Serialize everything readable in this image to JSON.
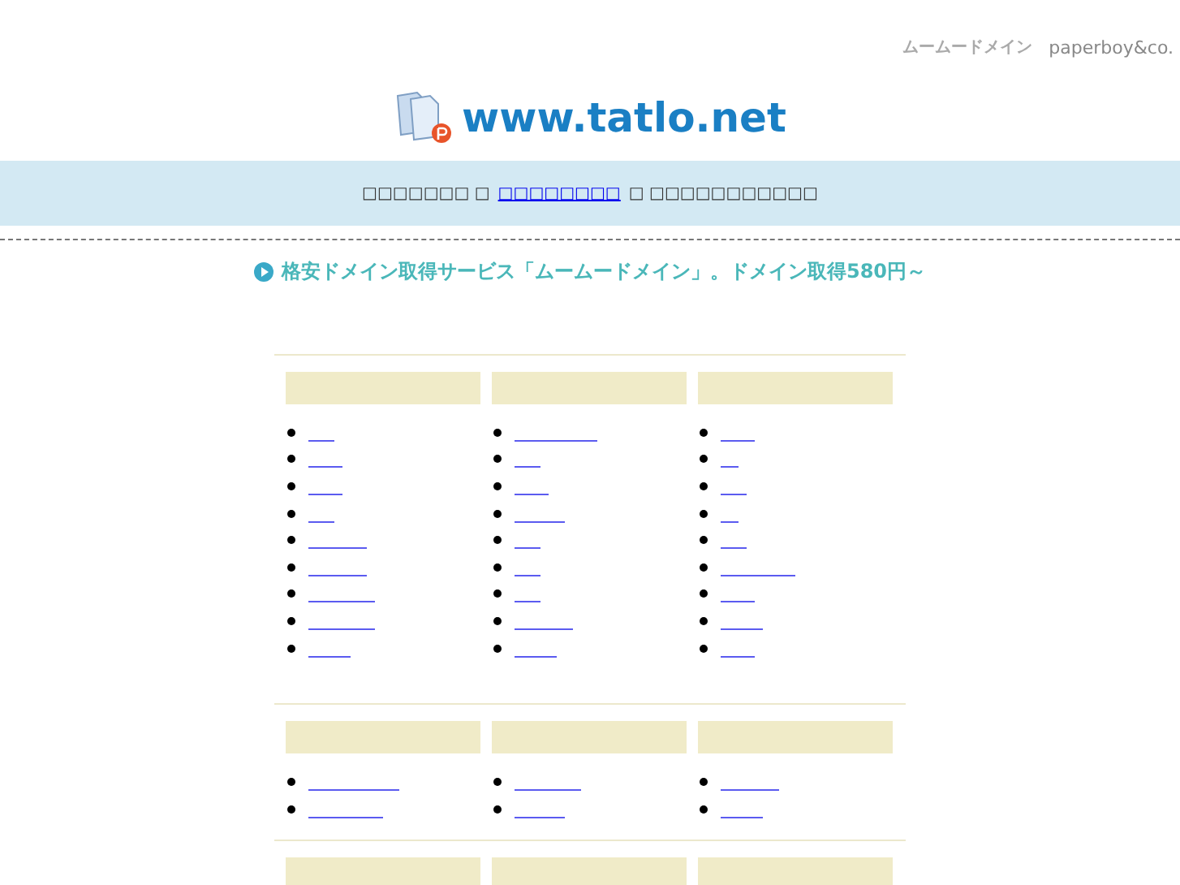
{
  "top_logos": [
    "ムームードメイン",
    "paperboy&co."
  ],
  "site_title": "www.tatlo.net",
  "notice": {
    "before": "□□□□□□□ □",
    "link": "□□□□□□□□",
    "after": "□ □□□□□□□□□□□"
  },
  "banner": "格安ドメイン取得サービス「ムームードメイン」。ドメイン取得580円～",
  "sections": [
    {
      "columns": [
        {
          "links": [
            {
              "kind": "link"
            },
            {
              "kind": "link"
            },
            {
              "kind": "link"
            },
            {
              "kind": "link"
            },
            {
              "kind": "link"
            },
            {
              "kind": "link"
            },
            {
              "kind": "link"
            },
            {
              "kind": "link"
            },
            {
              "kind": "link"
            }
          ]
        },
        {
          "links": [
            {
              "kind": "link"
            },
            {
              "kind": "link"
            },
            {
              "kind": "link"
            },
            {
              "kind": "link"
            },
            {
              "kind": "link"
            },
            {
              "kind": "link"
            },
            {
              "kind": "link"
            },
            {
              "kind": "link"
            },
            {
              "kind": "link"
            }
          ]
        },
        {
          "links": [
            {
              "kind": "link"
            },
            {
              "kind": "link"
            },
            {
              "kind": "link"
            },
            {
              "kind": "link"
            },
            {
              "kind": "link"
            },
            {
              "kind": "link"
            },
            {
              "kind": "link"
            },
            {
              "kind": "link"
            },
            {
              "kind": "link"
            }
          ]
        }
      ]
    },
    {
      "columns": [
        {
          "links": [
            {
              "kind": "link"
            },
            {
              "kind": "link"
            }
          ]
        },
        {
          "links": [
            {
              "kind": "link"
            },
            {
              "kind": "link"
            }
          ]
        },
        {
          "links": [
            {
              "kind": "link"
            },
            {
              "kind": "link"
            }
          ]
        }
      ]
    },
    {
      "columns": [
        {},
        {},
        {}
      ]
    }
  ]
}
